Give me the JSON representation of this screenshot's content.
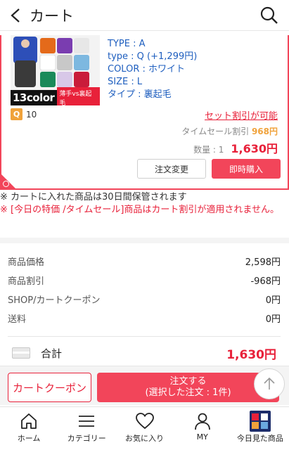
{
  "header": {
    "title": "カート"
  },
  "item": {
    "thumb_caption": "13color",
    "thumb_tag": "薄手vs裏起毛",
    "specs": [
      "TYPE : A",
      "type : Q (+1,299円)",
      "COLOR : ホワイト",
      "SIZE : L",
      "タイプ : 裏起毛"
    ],
    "points_icon": "Q",
    "points": "10",
    "set_discount": "セット割引が可能",
    "timesale_label": "タイムセール割引",
    "timesale_value": "968円",
    "quantity": "数量 : 1",
    "price": "1,630円",
    "change_button": "注文変更",
    "buy_button": "即時購入"
  },
  "notes": {
    "note1": "※ カートに入れた商品は30日間保管されます",
    "note2": "※ [今日の特価 /タイムセール]商品はカート割引が適用されません。"
  },
  "summary": {
    "rows": [
      {
        "label": "商品価格",
        "value": "2,598円"
      },
      {
        "label": "商品割引",
        "value": "-968円"
      },
      {
        "label": "SHOP/カートクーポン",
        "value": "0円"
      },
      {
        "label": "送料",
        "value": "0円"
      }
    ],
    "total_label": "合計",
    "total_value": "1,630円"
  },
  "bottom": {
    "coupon_button": "カートクーポン",
    "order_line1": "注文する",
    "order_line2": "(選択した注文 : 1件)"
  },
  "tabbar": {
    "items": [
      {
        "label": "ホーム",
        "icon": "home-icon"
      },
      {
        "label": "カテゴリー",
        "icon": "menu-icon"
      },
      {
        "label": "お気に入り",
        "icon": "heart-icon"
      },
      {
        "label": "MY",
        "icon": "person-icon"
      },
      {
        "label": "今日見た商品",
        "icon": "recent-product-thumbnail"
      }
    ]
  },
  "colors": {
    "accent": "#f2455a",
    "price": "#e8213a",
    "spec_text": "#1f5fbf",
    "points": "#f0a23b"
  }
}
